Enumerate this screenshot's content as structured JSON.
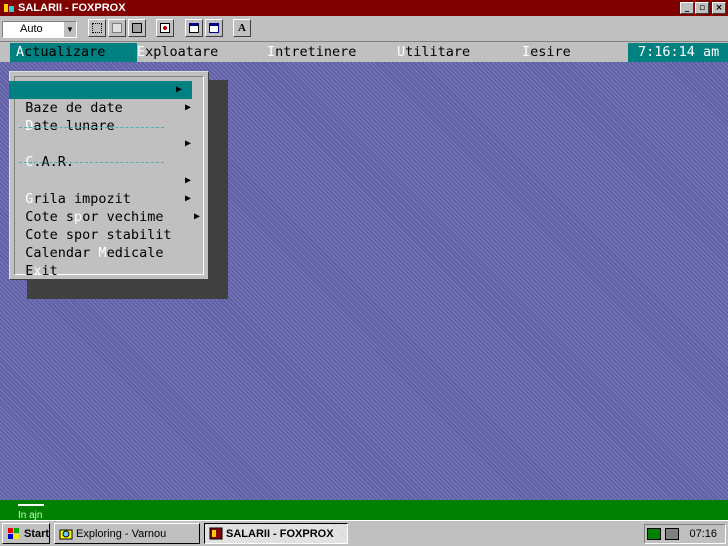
{
  "window": {
    "title": "SALARII - FOXPROX",
    "buttons": {
      "minimize": "_",
      "maximize": "▫",
      "close": "×"
    }
  },
  "toolbar": {
    "font_combo_value": "Auto",
    "combo_arrow": "▼",
    "font_button_label": "A",
    "icons": [
      "select-icon",
      "copy-icon",
      "paste-icon",
      "zoom-icon",
      "cascade-icon",
      "tile-icon",
      "font-icon"
    ]
  },
  "menubar": {
    "items": [
      {
        "hot": "A",
        "rest": "ctualizare"
      },
      {
        "hot": "E",
        "rest": "xploatare"
      },
      {
        "hot": "I",
        "rest": "ntretinere"
      },
      {
        "hot": "U",
        "rest": "tilitare"
      },
      {
        "hot": "I",
        "rest": "esire"
      }
    ],
    "clock": "7:16:14 am"
  },
  "dropdown": {
    "items": [
      {
        "pre": "",
        "hot": "B",
        "post": "aze de date",
        "submenu": true
      },
      {
        "pre": "",
        "hot": "D",
        "post": "ate lunare",
        "submenu": true
      },
      {
        "pre": "",
        "hot": "C",
        "post": ".A.R.",
        "submenu": true
      },
      {
        "pre": "",
        "hot": "G",
        "post": "rila impozit",
        "submenu": true
      },
      {
        "pre": "Cote s",
        "hot": "p",
        "post": "or vechime",
        "submenu": true
      },
      {
        "pre": "Cote spor stabilit",
        "hot": "",
        "post": "",
        "submenu": true
      },
      {
        "pre": "Calendar ",
        "hot": "M",
        "post": "edicale",
        "submenu": false
      },
      {
        "pre": "E",
        "hot": "x",
        "post": "it",
        "submenu": false
      }
    ],
    "arrow": "▶"
  },
  "statusbar": {
    "text": "In ajn"
  },
  "taskbar": {
    "start": "Start",
    "tasks": [
      {
        "label": "Exploring - Varnou"
      },
      {
        "label": "SALARII - FOXPROX"
      }
    ],
    "tray_time": "07:16"
  },
  "colors": {
    "titlebar": "#800000",
    "highlight": "#008080",
    "desktop": "#6060a8",
    "statusbar": "#008000"
  }
}
